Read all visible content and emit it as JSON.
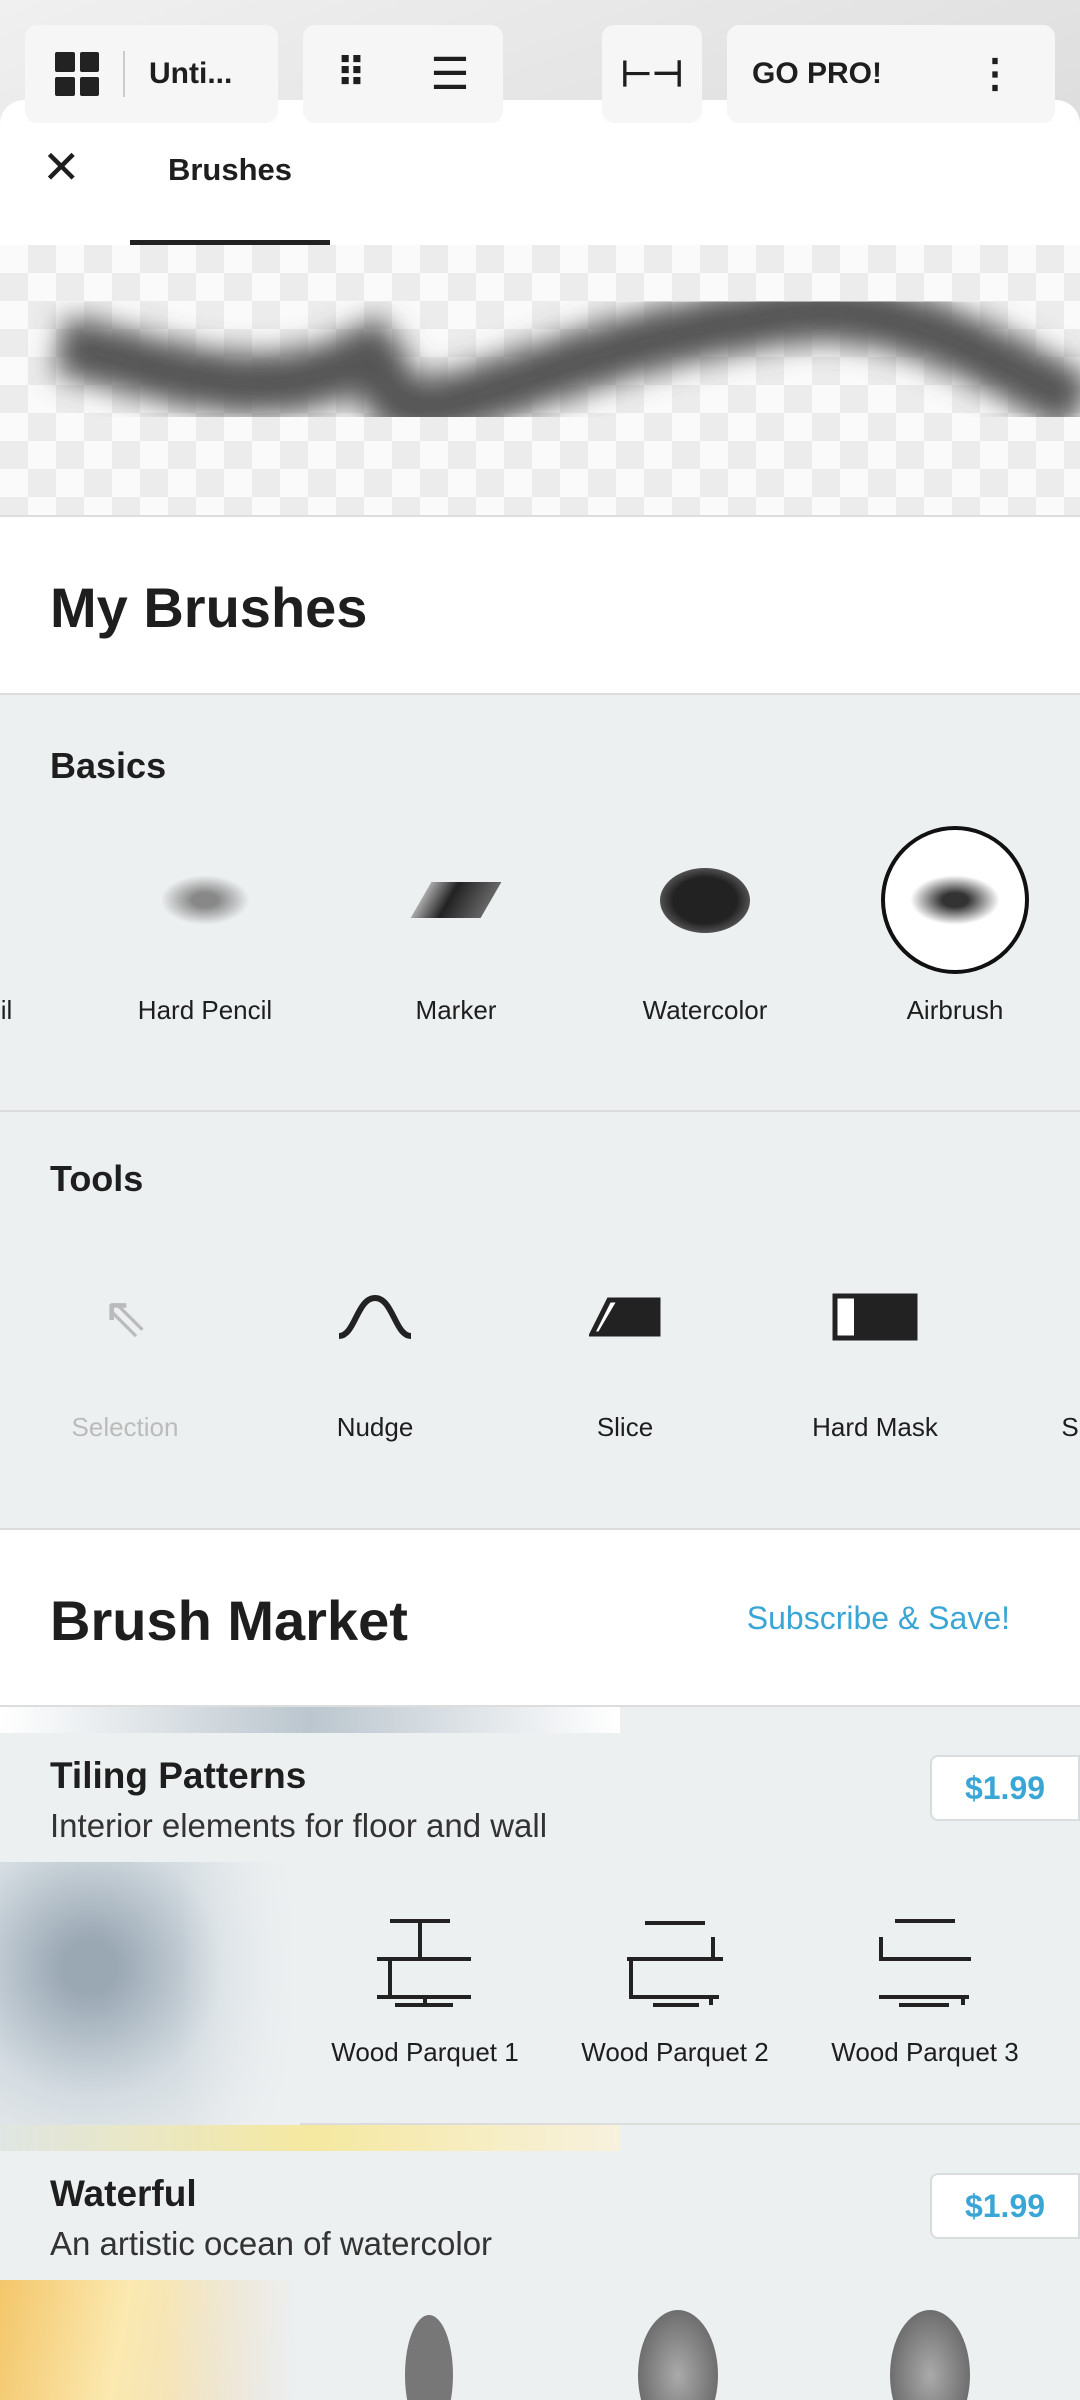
{
  "toolbar": {
    "title": "Unti...",
    "go_pro": "GO PRO!"
  },
  "tabs": [
    {
      "label": "Brushes",
      "active": true
    }
  ],
  "my_brushes": {
    "title": "My Brushes"
  },
  "basics": {
    "title": "Basics",
    "items": [
      {
        "label": "cil"
      },
      {
        "label": "Hard Pencil"
      },
      {
        "label": "Marker"
      },
      {
        "label": "Watercolor"
      },
      {
        "label": "Airbrush",
        "selected": true
      }
    ]
  },
  "tools": {
    "title": "Tools",
    "items": [
      {
        "label": "Selection",
        "disabled": true
      },
      {
        "label": "Nudge"
      },
      {
        "label": "Slice"
      },
      {
        "label": "Hard Mask"
      },
      {
        "label": "S"
      }
    ]
  },
  "market": {
    "title": "Brush Market",
    "subscribe": "Subscribe & Save!",
    "accent": "#3aa6d6",
    "packs": [
      {
        "title": "Tiling Patterns",
        "subtitle": "Interior elements for floor and wall",
        "price": "$1.99",
        "brushes": [
          {
            "label": "Wood Parquet 1"
          },
          {
            "label": "Wood Parquet 2"
          },
          {
            "label": "Wood Parquet 3"
          }
        ]
      },
      {
        "title": "Waterful",
        "subtitle": "An artistic ocean of watercolor",
        "price": "$1.99"
      }
    ]
  }
}
